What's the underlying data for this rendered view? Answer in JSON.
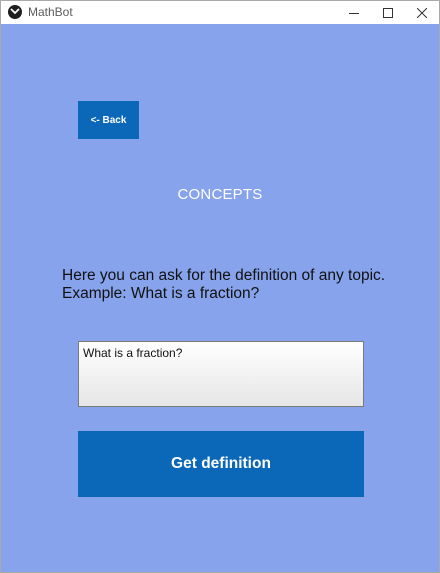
{
  "window": {
    "title": "MathBot",
    "icon": "mathbot-logo-icon",
    "controls": [
      "minimize-icon",
      "maximize-icon",
      "close-icon"
    ]
  },
  "back_button": {
    "label": "<- Back"
  },
  "page": {
    "title": "CONCEPTS",
    "instruction_line_1": "Here you can ask for the definition of any topic.",
    "instruction_line_2": "Example: What is a fraction?"
  },
  "question_input": {
    "value": "What is a fraction?"
  },
  "submit_button": {
    "label": "Get definition"
  },
  "colors": {
    "background": "#87a3ec",
    "button": "#0b68b9",
    "button_text": "#ffffff",
    "title_text": "#ffffff"
  }
}
